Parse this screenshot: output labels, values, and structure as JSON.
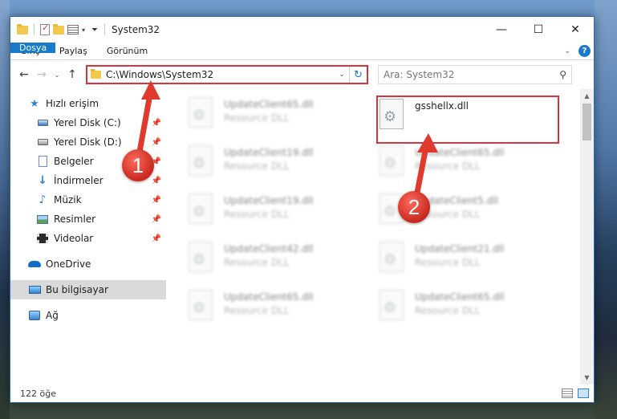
{
  "window": {
    "title": "System32",
    "controls": {
      "minimize": "—",
      "maximize": "☐",
      "close": "✕"
    }
  },
  "ribbon": {
    "tabs": [
      "Dosya",
      "Giriş",
      "Paylaş",
      "Görünüm"
    ],
    "help": "?"
  },
  "address": {
    "path": "C:\\Windows\\System32",
    "search_placeholder": "Ara: System32"
  },
  "nav": {
    "quick_access": "Hızlı erişim",
    "items": [
      {
        "label": "Yerel Disk (C:)",
        "icon": "drive-icon"
      },
      {
        "label": "Yerel Disk (D:)",
        "icon": "drive-icon"
      },
      {
        "label": "Belgeler",
        "icon": "documents-icon"
      },
      {
        "label": "İndirmeler",
        "icon": "downloads-icon"
      },
      {
        "label": "Müzik",
        "icon": "music-icon"
      },
      {
        "label": "Resimler",
        "icon": "pictures-icon"
      },
      {
        "label": "Videolar",
        "icon": "videos-icon"
      }
    ],
    "onedrive": "OneDrive",
    "this_pc": "Bu bilgisayar",
    "network": "Ağ"
  },
  "files": {
    "highlighted": {
      "name": "gsshellx.dll"
    },
    "left_column": [
      {
        "name": "UpdateClient65.dll",
        "desc": "Resource DLL"
      },
      {
        "name": "UpdateClient19.dll",
        "desc": "Resource DLL"
      },
      {
        "name": "UpdateClient19.dll",
        "desc": "Resource DLL"
      },
      {
        "name": "UpdateClient42.dll",
        "desc": "Resource DLL"
      },
      {
        "name": "UpdateClient65.dll",
        "desc": "Resource DLL"
      }
    ],
    "right_column": [
      {
        "name": "UpdateClient65.dll",
        "desc": "Resource DLL"
      },
      {
        "name": "UpdateClient5.dll",
        "desc": "Resource DLL"
      },
      {
        "name": "UpdateClient21.dll",
        "desc": "Resource DLL"
      },
      {
        "name": "UpdateClient65.dll",
        "desc": "Resource DLL"
      }
    ]
  },
  "status": {
    "count": "122 öğe"
  },
  "callouts": {
    "one": "1",
    "two": "2"
  },
  "colors": {
    "accent": "#1979ca",
    "highlight_red": "#d9343c",
    "callout_red": "#e0392d"
  }
}
